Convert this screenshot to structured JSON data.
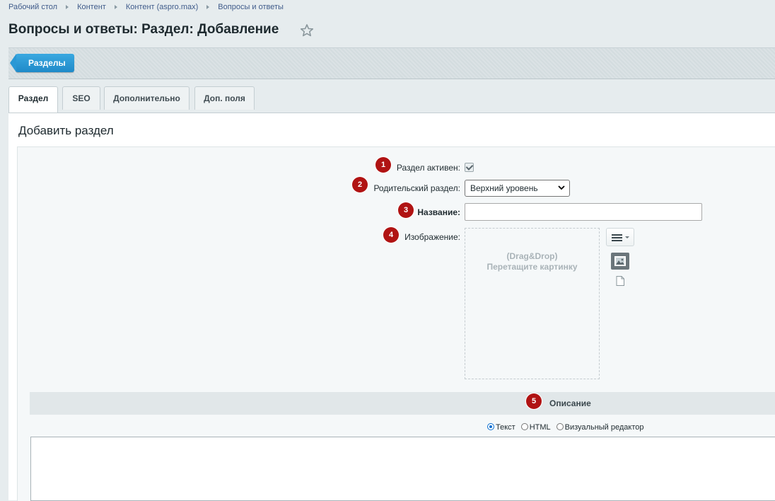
{
  "breadcrumb": [
    "Рабочий стол",
    "Контент",
    "Контент (aspro.max)",
    "Вопросы и ответы"
  ],
  "page_title": "Вопросы и ответы: Раздел: Добавление",
  "toolbar": {
    "back_label": "Разделы"
  },
  "tabs": [
    {
      "label": "Раздел",
      "active": true
    },
    {
      "label": "SEO",
      "active": false
    },
    {
      "label": "Дополнительно",
      "active": false
    },
    {
      "label": "Доп. поля",
      "active": false
    }
  ],
  "panel_title": "Добавить раздел",
  "form": {
    "active": {
      "label": "Раздел активен:",
      "badge": "1",
      "checked": true
    },
    "parent": {
      "label": "Родительский раздел:",
      "badge": "2",
      "value": "Верхний уровень"
    },
    "name": {
      "label": "Название:",
      "badge": "3",
      "value": ""
    },
    "image": {
      "label": "Изображение:",
      "badge": "4",
      "drop_line1": "(Drag&Drop)",
      "drop_line2": "Перетащите картинку"
    }
  },
  "description": {
    "title": "Описание",
    "badge": "5",
    "modes": [
      {
        "label": "Текст",
        "checked": true
      },
      {
        "label": "HTML",
        "checked": false
      },
      {
        "label": "Визуальный редактор",
        "checked": false
      }
    ],
    "value": ""
  },
  "colors": {
    "badge": "#b01313",
    "accent": "#1f8ac9"
  }
}
